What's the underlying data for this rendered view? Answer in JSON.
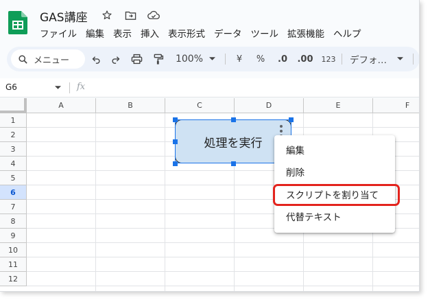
{
  "app": {
    "doc_title": "GAS講座",
    "logo_icon": "google-sheets-logo",
    "title_icons": [
      "star-icon",
      "move-to-folder-icon",
      "cloud-status-icon"
    ]
  },
  "menubar": [
    "ファイル",
    "編集",
    "表示",
    "挿入",
    "表示形式",
    "データ",
    "ツール",
    "拡張機能",
    "ヘルプ"
  ],
  "toolbar": {
    "search_label": "メニュー",
    "zoom": "100%",
    "currency": "¥",
    "percent": "%",
    "decrease_decimal": ".0",
    "increase_decimal": ".00",
    "number_format": "123",
    "font": "デフォ…"
  },
  "formula_bar": {
    "name_box": "G6",
    "fx_label": "fx"
  },
  "grid": {
    "columns": [
      "A",
      "B",
      "C",
      "D",
      "E",
      "F"
    ],
    "rows": [
      "1",
      "2",
      "3",
      "4",
      "5",
      "6",
      "7",
      "8",
      "9",
      "10",
      "11",
      "12"
    ],
    "selected_row": "6"
  },
  "drawing": {
    "label": "処理を実行",
    "fill_color": "#cfe2f3"
  },
  "context_menu": {
    "items": [
      "編集",
      "削除",
      "スクリプトを割り当て",
      "代替テキスト"
    ],
    "highlighted_item": "スクリプトを割り当て",
    "highlight_color": "#e3231d"
  }
}
